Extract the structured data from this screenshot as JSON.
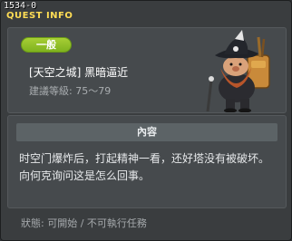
{
  "header": {
    "quest_id": "1534-0",
    "title": "QUEST INFO"
  },
  "quest": {
    "category": "一般",
    "name": "[天空之城] 黑暗逼近",
    "level_label": "建議等級: 75～79"
  },
  "content": {
    "header": "內容",
    "text": "时空门爆炸后，打起精神一看，还好塔没有被破坏。向何克询问这是怎么回事。"
  },
  "status": {
    "text": "狀態: 可開始 / 不可執行任務"
  },
  "colors": {
    "accent_title": "#ffdd55",
    "badge": "#8fc028",
    "panel": "#464a4d",
    "background": "#3a3d3f"
  },
  "icons": {
    "npc": "pirate-npc-portrait"
  }
}
